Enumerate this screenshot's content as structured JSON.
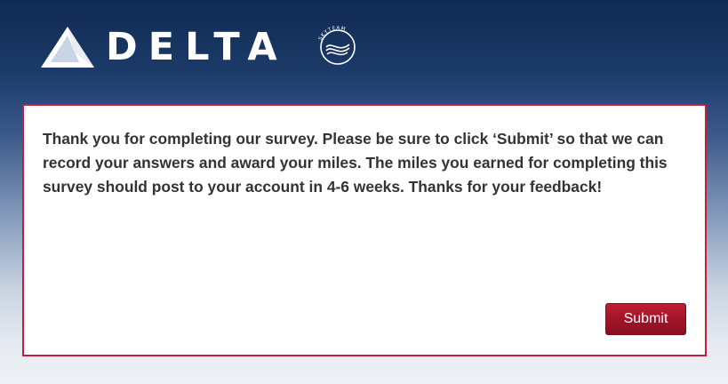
{
  "header": {
    "brand_name": "DELTA",
    "partner_text": "SKYTEAM"
  },
  "survey": {
    "message": "Thank you for completing our survey.  Please be sure to click ‘Submit’ so that we can record your answers and award your miles.  The miles you earned for completing this survey should post to your account in 4-6 weeks.  Thanks for your feedback!",
    "submit_label": "Submit"
  },
  "colors": {
    "brand_red": "#c0213a",
    "header_navy": "#0f2a52",
    "text": "#333333"
  },
  "icons": {
    "brand": "delta-widget-icon",
    "partner": "skyteam-logo-icon"
  }
}
